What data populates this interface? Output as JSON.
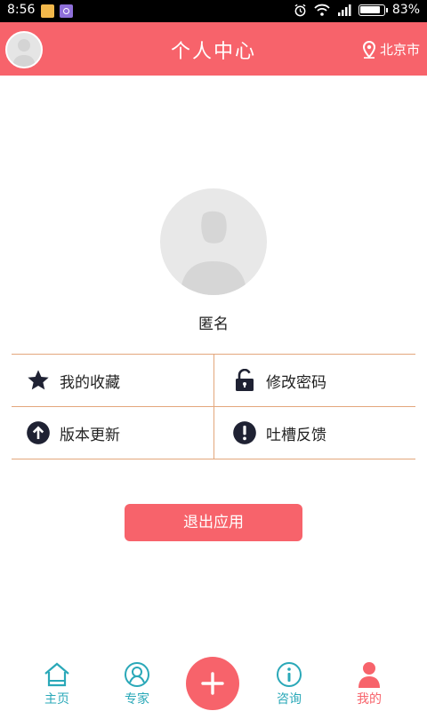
{
  "status_bar": {
    "time": "8:56",
    "battery": "83%"
  },
  "header": {
    "title": "个人中心",
    "location": "北京市"
  },
  "profile": {
    "username": "匿名"
  },
  "menu": {
    "favorites": "我的收藏",
    "change_password": "修改密码",
    "version_update": "版本更新",
    "feedback": "吐槽反馈"
  },
  "logout_label": "退出应用",
  "bottom_nav": {
    "home": "主页",
    "experts": "专家",
    "consult": "咨询",
    "mine": "我的"
  },
  "colors": {
    "accent": "#f7636b",
    "nav_teal": "#2aa8b8",
    "divider": "#e3a77c"
  }
}
